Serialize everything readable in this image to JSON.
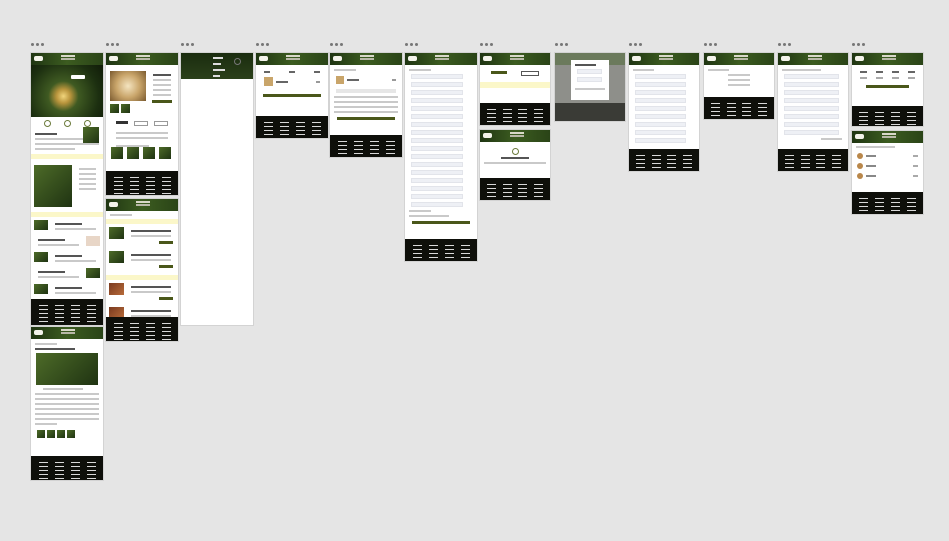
{
  "canvas": {
    "background": "#e5e5e5"
  },
  "theme": {
    "accent": "#4a571a",
    "nav": "#2a4417",
    "footer": "#0e0f0a",
    "highlight": "#fbf7c9"
  },
  "artboards": [
    {
      "id": "home"
    },
    {
      "id": "product"
    },
    {
      "id": "menu-overlay"
    },
    {
      "id": "cart"
    },
    {
      "id": "cart-summary"
    },
    {
      "id": "checkout-form"
    },
    {
      "id": "order-confirmation"
    },
    {
      "id": "modal"
    },
    {
      "id": "account-form"
    },
    {
      "id": "account-menu"
    },
    {
      "id": "settings"
    },
    {
      "id": "orders-list"
    },
    {
      "id": "blog-list"
    },
    {
      "id": "article"
    }
  ],
  "menu_items": [
    "",
    "",
    "",
    ""
  ]
}
